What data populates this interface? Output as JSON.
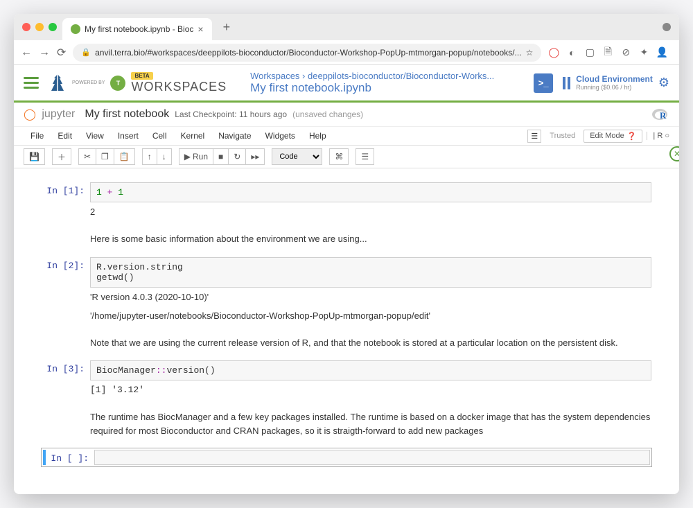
{
  "browser": {
    "tab_title": "My first notebook.ipynb - Bioc",
    "url": "anvil.terra.bio/#workspaces/deeppilots-bioconductor/Bioconductor-Workshop-PopUp-mtmorgan-popup/notebooks/...",
    "star": "☆"
  },
  "terra": {
    "powered": "POWERED BY",
    "beta": "BETA",
    "workspaces": "WORKSPACES",
    "breadcrumb": "Workspaces › deeppilots-bioconductor/Bioconductor-Works...",
    "title": "My first notebook.ipynb",
    "cloud_title": "Cloud Environment",
    "cloud_status": "Running ($0.06 / hr)"
  },
  "jupyter": {
    "logo": "jupyter",
    "name": "My first notebook",
    "checkpoint": "Last Checkpoint: 11 hours ago",
    "unsaved": "(unsaved changes)",
    "menu": [
      "File",
      "Edit",
      "View",
      "Insert",
      "Cell",
      "Kernel",
      "Navigate",
      "Widgets",
      "Help"
    ],
    "trusted": "Trusted",
    "mode": "Edit Mode",
    "lang": "R",
    "toolbar": {
      "run": "Run",
      "cell_type": "Code"
    }
  },
  "cells": {
    "c1": {
      "prompt": "In [1]:",
      "code_pre": "1",
      "code_op": " + ",
      "code_post": "1",
      "output": "2"
    },
    "md1": "Here is some basic information about the environment we are using...",
    "c2": {
      "prompt": "In [2]:",
      "code": "R.version.string\ngetwd()",
      "out1": "'R version 4.0.3 (2020-10-10)'",
      "out2": "'/home/jupyter-user/notebooks/Bioconductor-Workshop-PopUp-mtmorgan-popup/edit'"
    },
    "md2": "Note that we are using the current release version of R, and that the notebook is stored at a particular location on the persistent disk.",
    "c3": {
      "prompt": "In [3]:",
      "code_a": "BiocManager",
      "code_b": "::",
      "code_c": "version()",
      "output": "[1] '3.12'"
    },
    "md3": "The runtime has BiocManager and a few key packages installed. The runtime is based on a docker image that has the system dependencies required for most Bioconductor and CRAN packages, so it is straigth-forward to add new packages",
    "c4": {
      "prompt": "In [ ]:"
    }
  }
}
